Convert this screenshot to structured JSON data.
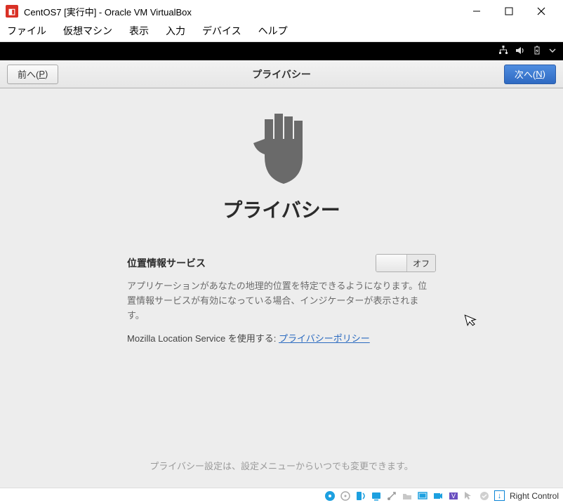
{
  "titlebar": {
    "title": "CentOS7 [実行中] - Oracle VM VirtualBox"
  },
  "menubar": {
    "file": "ファイル",
    "machine": "仮想マシン",
    "view": "表示",
    "input": "入力",
    "devices": "デバイス",
    "help": "ヘルプ"
  },
  "headerbar": {
    "prev_prefix": "前へ(",
    "prev_key": "P",
    "prev_suffix": ")",
    "title": "プライバシー",
    "next_prefix": "次へ(",
    "next_key": "N",
    "next_suffix": ")"
  },
  "privacy": {
    "heading": "プライバシー",
    "location_label": "位置情報サービス",
    "switch_state": "オフ",
    "description": "アプリケーションがあなたの地理的位置を特定できるようになります。位置情報サービスが有効になっている場合、インジケーターが表示されます。",
    "link_prefix": "Mozilla Location Service を使用する: ",
    "link_text": "プライバシーポリシー",
    "footer": "プライバシー設定は、設定メニューからいつでも変更できます。"
  },
  "statusbar": {
    "hostkey": "Right Control"
  }
}
